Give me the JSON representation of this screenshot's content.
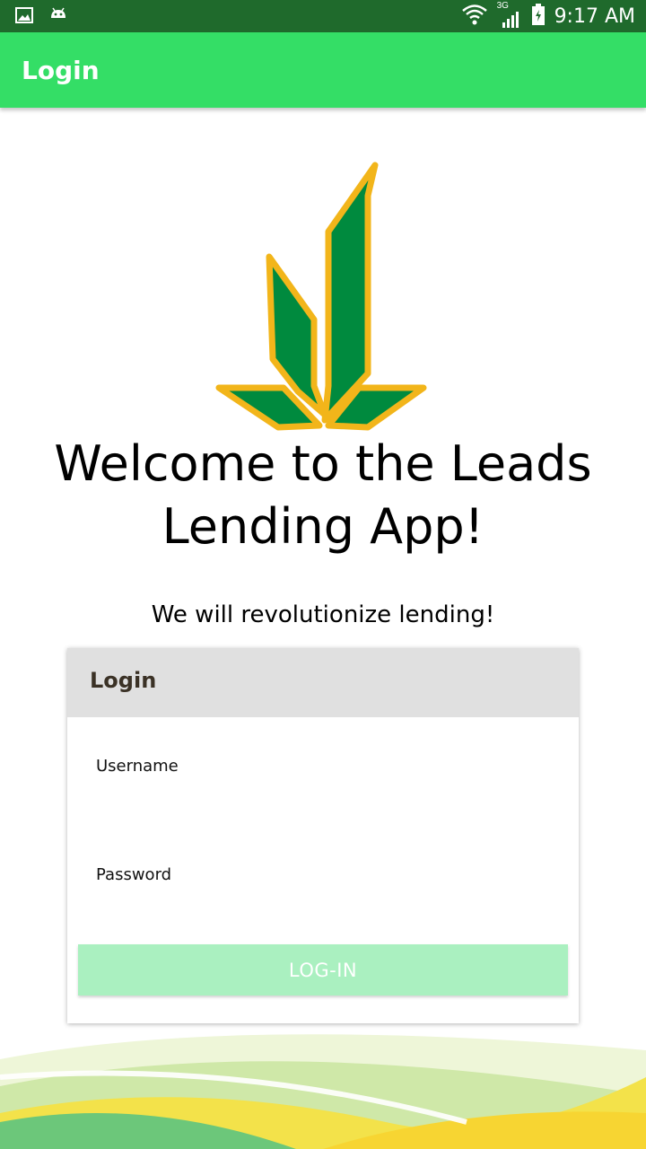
{
  "status_bar": {
    "left_icons": [
      "image-icon",
      "android-icon"
    ],
    "right_icons": [
      "wifi-icon",
      "signal-3g-icon",
      "battery-icon"
    ],
    "network_label": "3G",
    "time": "9:17 AM"
  },
  "app_bar": {
    "title": "Login",
    "color": "#34de66"
  },
  "hero": {
    "logo": "leads-lending-logo",
    "welcome_line1": "Welcome to the Leads",
    "welcome_line2": "Lending App!",
    "tagline": "We will revolutionize lending!"
  },
  "login_card": {
    "title": "Login",
    "username_label": "Username",
    "username_value": "",
    "password_label": "Password",
    "password_value": "",
    "submit_label": "LOG-IN"
  },
  "colors": {
    "status_bar": "#1f6a2c",
    "logo_green": "#008a3e",
    "logo_gold": "#f2b51a",
    "button_disabled": "#aaf0c0"
  }
}
